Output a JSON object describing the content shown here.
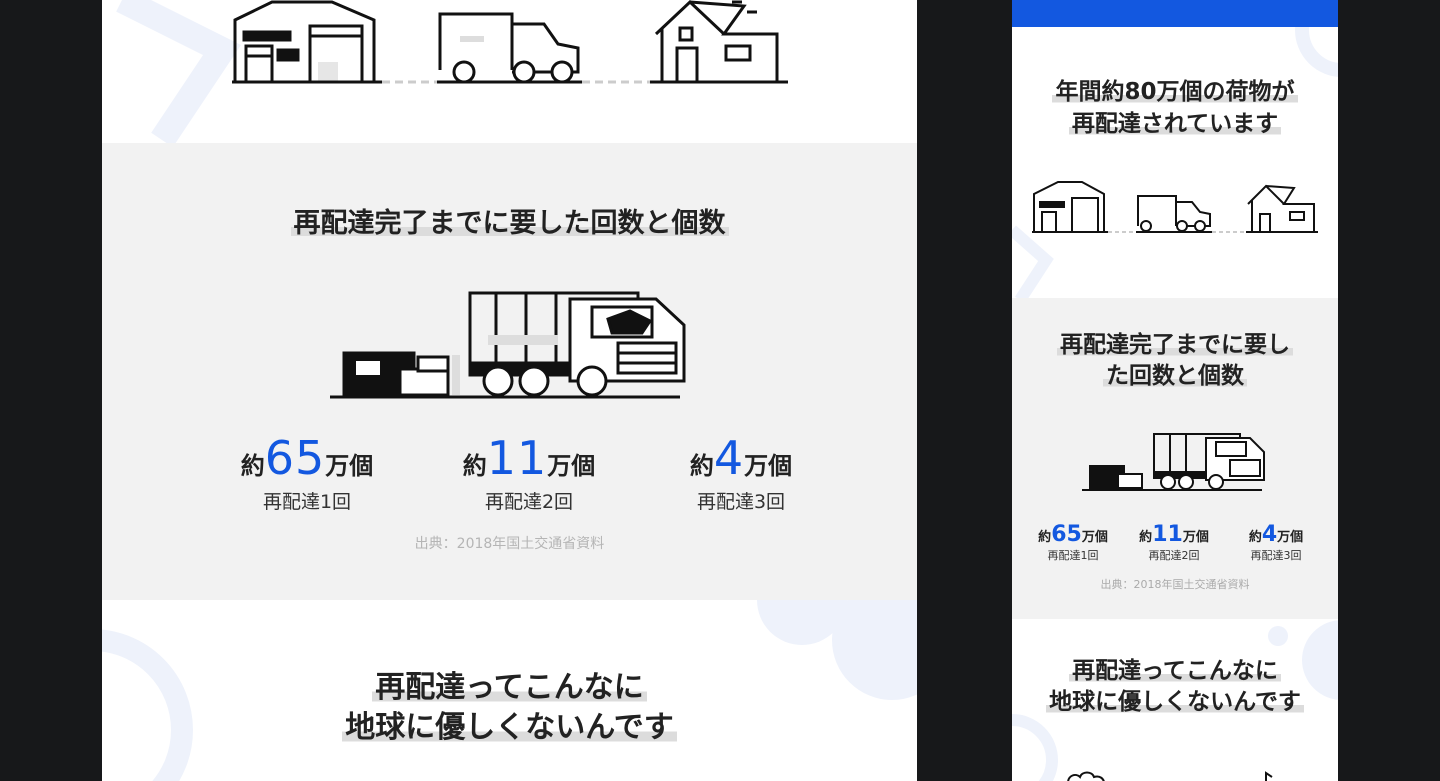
{
  "desktop": {
    "section_stats": {
      "title": "再配達完了までに要した回数と個数",
      "stats": [
        {
          "prefix": "約",
          "value": "65",
          "suffix": "万個",
          "label": "再配達1回"
        },
        {
          "prefix": "約",
          "value": "11",
          "suffix": "万個",
          "label": "再配達2回"
        },
        {
          "prefix": "約",
          "value": "4",
          "suffix": "万個",
          "label": "再配達3回"
        }
      ],
      "source": "出典：2018年国土交通省資料"
    },
    "section_earth": {
      "title_line1": "再配達ってこんなに",
      "title_line2": "地球に優しくないんです"
    }
  },
  "mobile": {
    "intro": {
      "title_line1": "年間約80万個の荷物が",
      "title_line2": "再配達されています"
    },
    "section_stats": {
      "title_line1": "再配達完了までに要し",
      "title_line2": "た回数と個数",
      "stats": [
        {
          "prefix": "約",
          "value": "65",
          "suffix": "万個",
          "label": "再配達1回"
        },
        {
          "prefix": "約",
          "value": "11",
          "suffix": "万個",
          "label": "再配達2回"
        },
        {
          "prefix": "約",
          "value": "4",
          "suffix": "万個",
          "label": "再配達3回"
        }
      ],
      "source": "出典：2018年国土交通省資料"
    },
    "section_earth": {
      "title_line1": "再配達ってこんなに",
      "title_line2": "地球に優しくないんです"
    }
  },
  "colors": {
    "accent": "#1358e0",
    "page_background": "#17181a",
    "section_gray": "#f2f2f2",
    "decoration": "#eef2fb"
  },
  "icons": [
    "warehouse-icon",
    "delivery-van-icon",
    "house-icon",
    "box-icon",
    "truck-icon",
    "cloud-icon",
    "music-note-icon"
  ]
}
